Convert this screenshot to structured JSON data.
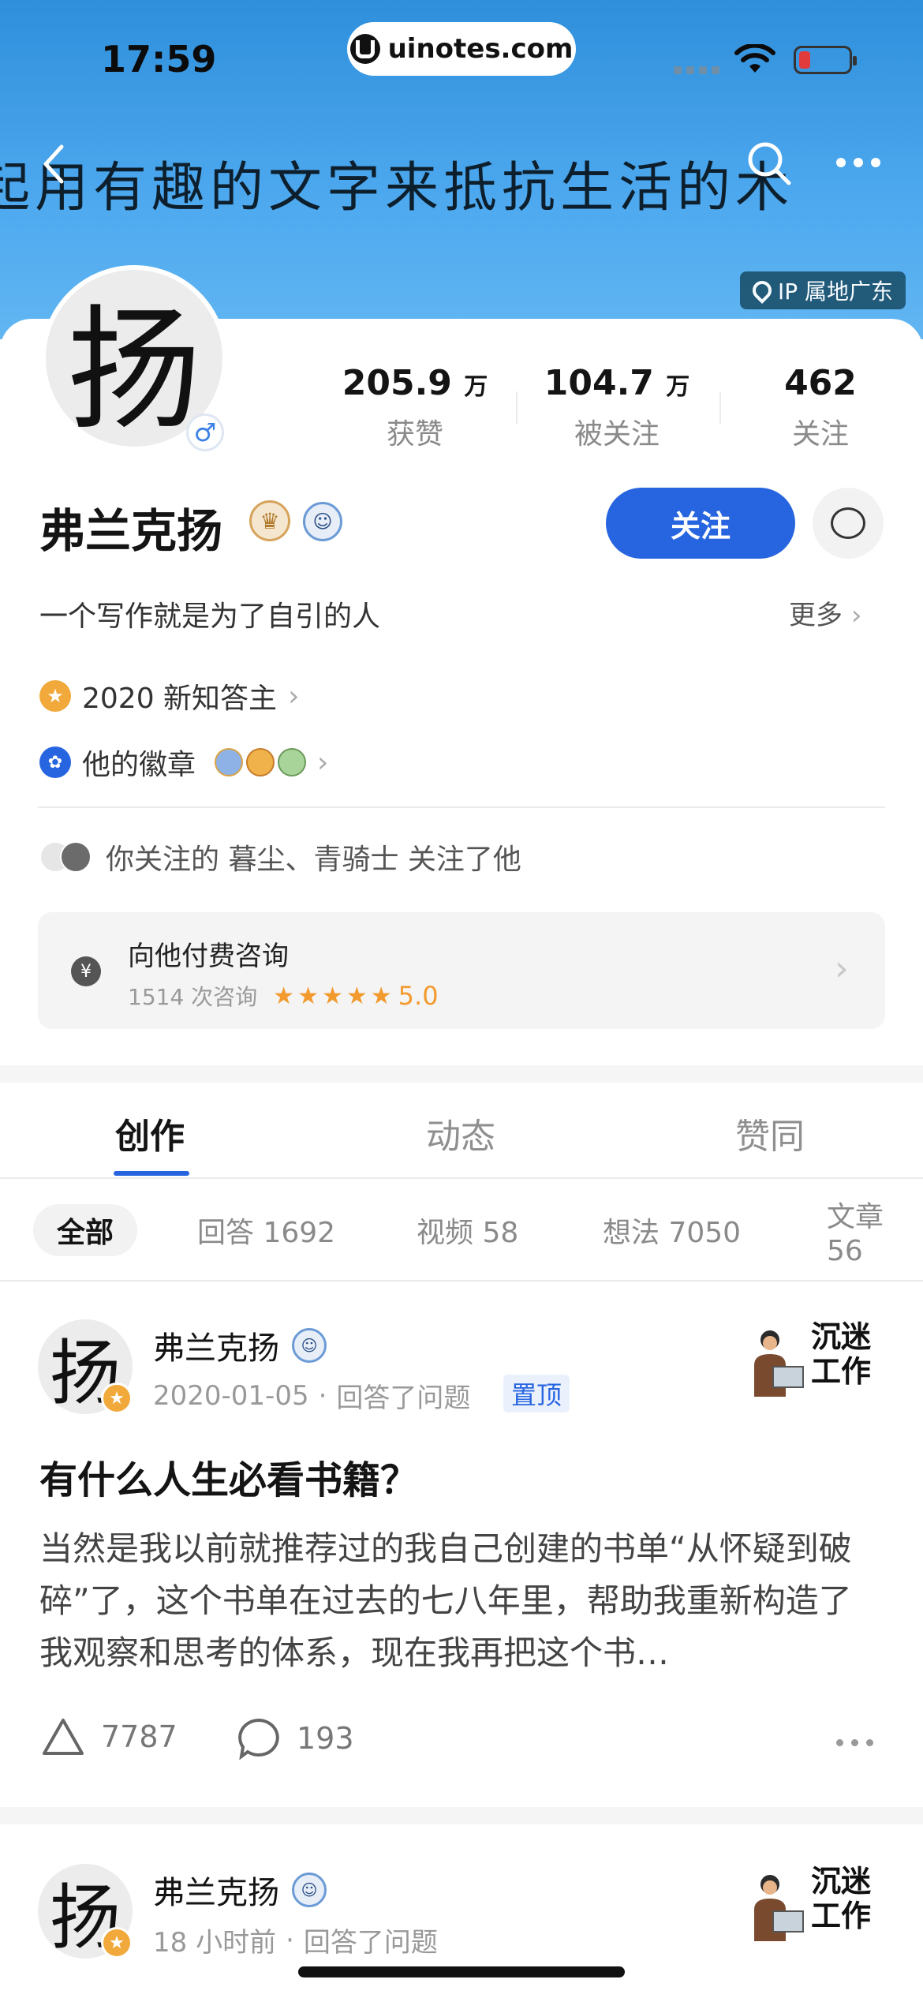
{
  "status_bar": {
    "time": "17:59",
    "url": "uinotes.com"
  },
  "banner": {
    "text": "起用有趣的文字来抵抗生活的木"
  },
  "ip_badge": "IP 属地广东",
  "profile": {
    "avatar_char": "扬",
    "gender": "♂",
    "name": "弗兰克扬",
    "stats": [
      {
        "num": "205.9",
        "unit": "万",
        "label": "获赞"
      },
      {
        "num": "104.7",
        "unit": "万",
        "label": "被关注"
      },
      {
        "num": "462",
        "unit": "",
        "label": "关注"
      }
    ],
    "follow_label": "关注",
    "bio": "一个写作就是为了自引的人",
    "more_label": "更多",
    "honor": "2020 新知答主",
    "badges_label": "他的徽章",
    "mutual": "你关注的 暮尘、青骑士 关注了他"
  },
  "consult": {
    "title": "向他付费咨询",
    "count": "1514 次咨询",
    "rating": "5.0",
    "stars": 5
  },
  "tabs": [
    "创作",
    "动态",
    "赞同"
  ],
  "filters": [
    "全部",
    "回答 1692",
    "视频 58",
    "想法 7050",
    "文章 56"
  ],
  "posts": [
    {
      "author": "弗兰克扬",
      "date": "2020-01-05",
      "action": "回答了问题",
      "pin_label": "置顶",
      "sticker_text_1": "沉迷",
      "sticker_text_2": "工作",
      "title": "有什么人生必看书籍？",
      "body": "当然是我以前就推荐过的我自己创建的书单“从怀疑到破碎”了，这个书单在过去的七八年里，帮助我重新构造了我观察和思考的体系，现在我再把这个书…",
      "likes": "7787",
      "comments": "193"
    },
    {
      "author": "弗兰克扬",
      "date": "18 小时前",
      "action": "回答了问题",
      "sticker_text_1": "沉迷",
      "sticker_text_2": "工作"
    }
  ],
  "colors": {
    "accent": "#2765e0",
    "banner": "#4ea9ef",
    "star": "#f2a93b"
  }
}
